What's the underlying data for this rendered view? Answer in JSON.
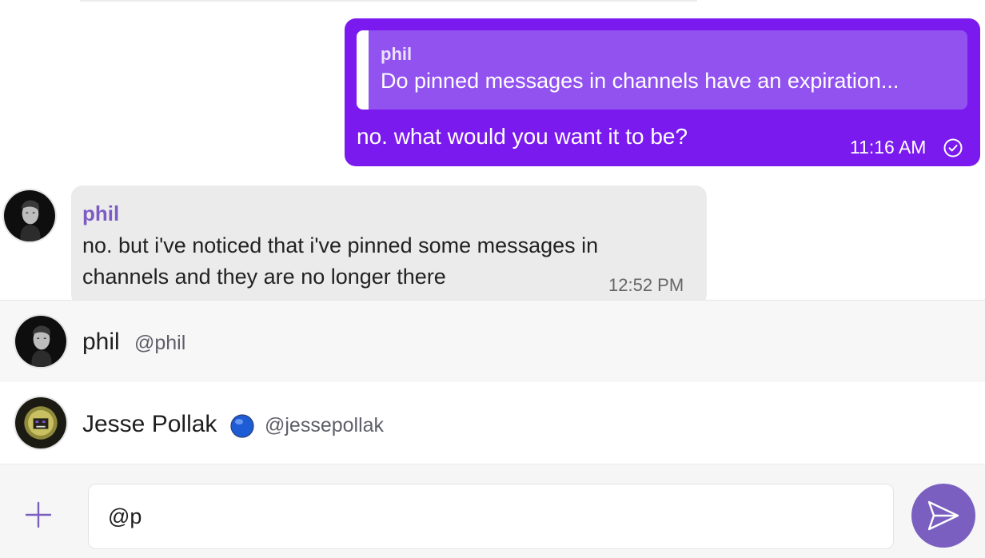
{
  "messages": {
    "outgoing": {
      "quote_author": "phil",
      "quote_text": "Do pinned messages in channels have an expiration...",
      "text": "no. what would you want it to be?",
      "time": "11:16 AM",
      "status_icon": "check-circle-icon"
    },
    "incoming": {
      "author": "phil",
      "text": "no. but i've noticed that i've pinned some messages in channels and they are no longer there",
      "time": "12:52 PM"
    }
  },
  "mentions": [
    {
      "name": "phil",
      "handle": "@phil"
    },
    {
      "name": "Jesse Pollak",
      "handle": "@jessepollak",
      "badge_icon": "blue-circle-icon"
    }
  ],
  "composer": {
    "value": "@p",
    "plus_icon": "plus-icon",
    "send_icon": "send-icon"
  },
  "colors": {
    "outgoing_bubble": "#7a1aee",
    "quote_block": "#9152f0",
    "incoming_bubble": "#ebebeb",
    "author_accent": "#7c5cc4",
    "send_button": "#7a5fc0",
    "badge_blue": "#1e5cd6"
  }
}
